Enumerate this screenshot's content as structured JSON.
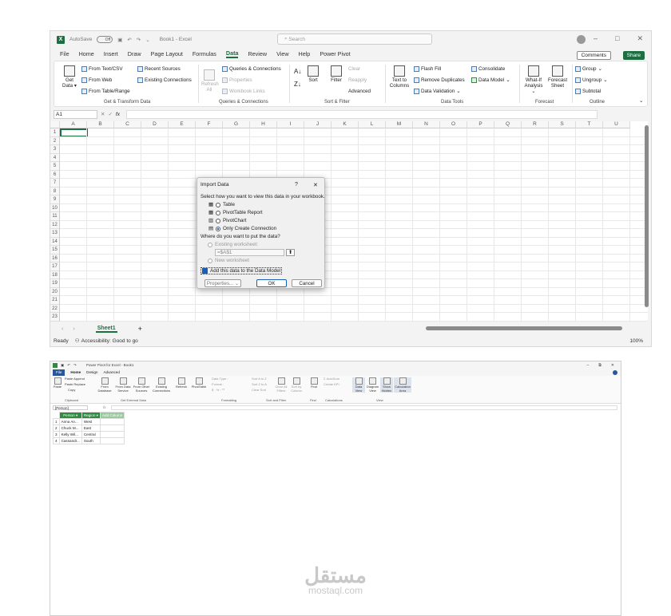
{
  "excel": {
    "autosave": "AutoSave",
    "autosave_state": "Off",
    "doc_title": "Book1 - Excel",
    "search_placeholder": "Search",
    "tabs": [
      "File",
      "Home",
      "Insert",
      "Draw",
      "Page Layout",
      "Formulas",
      "Data",
      "Review",
      "View",
      "Help",
      "Power Pivot"
    ],
    "active_tab": "Data",
    "comments": "Comments",
    "share": "Share",
    "ribbon": {
      "get_data": "Get Data",
      "from_text_csv": "From Text/CSV",
      "from_web": "From Web",
      "from_table_range": "From Table/Range",
      "recent_sources": "Recent Sources",
      "existing_connections": "Existing Connections",
      "group_get_transform": "Get & Transform Data",
      "refresh_all": "Refresh All",
      "queries_connections": "Queries & Connections",
      "properties": "Properties",
      "workbook_links": "Workbook Links",
      "group_queries": "Queries & Connections",
      "sort": "Sort",
      "filter": "Filter",
      "clear": "Clear",
      "reapply": "Reapply",
      "advanced": "Advanced",
      "group_sort_filter": "Sort & Filter",
      "text_to_columns": "Text to Columns",
      "flash_fill": "Flash Fill",
      "remove_duplicates": "Remove Duplicates",
      "data_validation": "Data Validation",
      "consolidate": "Consolidate",
      "data_model": "Data Model",
      "group_data_tools": "Data Tools",
      "what_if": "What-If Analysis",
      "forecast_sheet": "Forecast Sheet",
      "group_forecast": "Forecast",
      "group": "Group",
      "ungroup": "Ungroup",
      "subtotal": "Subtotal",
      "group_outline": "Outline"
    },
    "name_box": "A1",
    "fx": "fx",
    "columns": [
      "A",
      "B",
      "C",
      "D",
      "E",
      "F",
      "G",
      "H",
      "I",
      "J",
      "K",
      "L",
      "M",
      "N",
      "O",
      "P",
      "Q",
      "R",
      "S",
      "T",
      "U"
    ],
    "rows": [
      "1",
      "2",
      "3",
      "4",
      "5",
      "6",
      "7",
      "8",
      "9",
      "10",
      "11",
      "12",
      "13",
      "14",
      "15",
      "16",
      "17",
      "18",
      "19",
      "20",
      "21",
      "22",
      "23"
    ],
    "sheet_tab": "Sheet1",
    "add_sheet": "+",
    "status_ready": "Ready",
    "status_accessibility": "Accessibility: Good to go",
    "zoom": "100%"
  },
  "dialog": {
    "title": "Import Data",
    "help": "?",
    "close": "✕",
    "prompt": "Select how you want to view this data in your workbook.",
    "opt_table": "Table",
    "opt_pivot_report": "PivotTable Report",
    "opt_pivot_chart": "PivotChart",
    "opt_only_connection": "Only Create Connection",
    "where_prompt": "Where do you want to put the data?",
    "existing_worksheet": "Existing worksheet:",
    "range_value": "=$A$1",
    "new_worksheet": "New worksheet",
    "add_to_model": "Add this data to the Data Model",
    "properties": "Properties...",
    "ok": "OK",
    "cancel": "Cancel"
  },
  "powerpivot": {
    "title": "Power Pivot for Excel - Book1",
    "tabs": [
      "File",
      "Home",
      "Design",
      "Advanced"
    ],
    "ribbon": {
      "paste": "Paste",
      "paste_append": "Paste Append",
      "paste_replace": "Paste Replace",
      "copy": "Copy",
      "group_clipboard": "Clipboard",
      "from_database": "From Database",
      "from_data_service": "From Data Service",
      "from_other_sources": "From Other Sources",
      "existing_connections": "Existing Connections",
      "group_external": "Get External Data",
      "refresh": "Refresh",
      "pivottable": "PivotTable",
      "data_type": "Data Type :",
      "format": "Format :",
      "group_formatting": "Formatting",
      "sort_a_z": "Sort A to Z",
      "sort_z_a": "Sort Z to A",
      "clear_sort": "Clear Sort",
      "clear_all_filters": "Clear All Filters",
      "sort_by_column": "Sort by Column",
      "group_sort_filter": "Sort and Filter",
      "find": "Find",
      "group_find": "Find",
      "autosum": "AutoSum",
      "create_kpi": "Create KPI",
      "group_calculations": "Calculations",
      "data_view": "Data View",
      "diagram_view": "Diagram View",
      "show_hidden": "Show Hidden",
      "calculation_area": "Calculation Area",
      "group_view": "View"
    },
    "name_box": "[Person]",
    "fx": "fx",
    "headers": [
      "Person",
      "Region",
      "Add Column"
    ],
    "rows": [
      [
        "1",
        "Anna An...",
        "West"
      ],
      [
        "2",
        "Chuck M...",
        "East"
      ],
      [
        "3",
        "Kelly Wil...",
        "Central"
      ],
      [
        "4",
        "Cassandr...",
        "South"
      ]
    ]
  },
  "watermark": {
    "arabic": "مستقل",
    "latin": "mostaql.com"
  }
}
